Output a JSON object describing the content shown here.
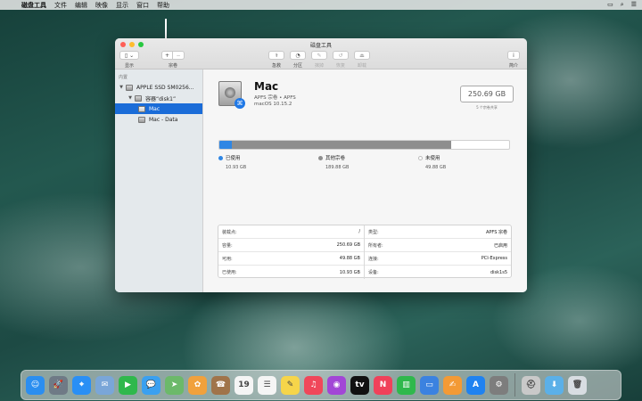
{
  "menubar": {
    "items": [
      "磁盘工具",
      "文件",
      "编辑",
      "映像",
      "显示",
      "窗口",
      "帮助"
    ]
  },
  "window": {
    "title": "磁盘工具",
    "toolbar": {
      "show_label": "显示",
      "volume_label": "宗卷",
      "firstaid_label": "急救",
      "partition_label": "分区",
      "erase_label": "抹掉",
      "restore_label": "恢复",
      "mount_label": "卸载",
      "info_label": "简介"
    }
  },
  "sidebar": {
    "section": "内置",
    "items": [
      {
        "label": "APPLE SSD SM0256..."
      },
      {
        "label": "容器“disk1”"
      },
      {
        "label": "Mac"
      },
      {
        "label": "Mac - Data"
      }
    ]
  },
  "volume": {
    "name": "Mac",
    "subtitle": "APFS 宗卷 • APFS",
    "os": "macOS 10.15.2",
    "capacity": "250.69 GB",
    "capacity_note": "5 个宗卷共享"
  },
  "usage": {
    "used_fraction": 0.0437,
    "other_fraction": 0.7568,
    "colors": {
      "used": "#2f86e4",
      "other": "#8e8e8e",
      "free": "#ffffff"
    },
    "legend": [
      {
        "label": "已使用",
        "value": "10.93 GB"
      },
      {
        "label": "其他宗卷",
        "value": "189.88 GB"
      },
      {
        "label": "未使用",
        "value": "49.88 GB"
      }
    ]
  },
  "info": {
    "left": [
      {
        "k": "装载点:",
        "v": "/"
      },
      {
        "k": "容量:",
        "v": "250.69 GB"
      },
      {
        "k": "可用:",
        "v": "49.88 GB"
      },
      {
        "k": "已使用:",
        "v": "10.93 GB"
      }
    ],
    "right": [
      {
        "k": "类型:",
        "v": "APFS 宗卷"
      },
      {
        "k": "所有者:",
        "v": "已启用"
      },
      {
        "k": "连接:",
        "v": "PCI-Express"
      },
      {
        "k": "设备:",
        "v": "disk1s5"
      }
    ]
  },
  "dock": {
    "apps": [
      {
        "name": "finder-icon",
        "glyph": "☺",
        "color": "#2b8ef0"
      },
      {
        "name": "launchpad-icon",
        "glyph": "🚀",
        "color": "#6f7a86"
      },
      {
        "name": "safari-icon",
        "glyph": "⌖",
        "color": "#2a8ff5"
      },
      {
        "name": "mail-icon",
        "glyph": "✉",
        "color": "#7aa6d8"
      },
      {
        "name": "facetime-icon",
        "glyph": "▶",
        "color": "#2fb84c"
      },
      {
        "name": "messages-icon",
        "glyph": "💬",
        "color": "#3aa0f0"
      },
      {
        "name": "maps-icon",
        "glyph": "➤",
        "color": "#6cb96a"
      },
      {
        "name": "photos-icon",
        "glyph": "✿",
        "color": "#f1a13c"
      },
      {
        "name": "contacts-icon",
        "glyph": "☎",
        "color": "#a0744a"
      },
      {
        "name": "calendar-icon",
        "glyph": "19",
        "color": "#f5f5f5"
      },
      {
        "name": "reminders-icon",
        "glyph": "☰",
        "color": "#f5f5f5"
      },
      {
        "name": "notes-icon",
        "glyph": "✎",
        "color": "#f6d54a"
      },
      {
        "name": "music-icon",
        "glyph": "♫",
        "color": "#f0475a"
      },
      {
        "name": "podcasts-icon",
        "glyph": "◉",
        "color": "#a246d6"
      },
      {
        "name": "tv-icon",
        "glyph": "tv",
        "color": "#111111"
      },
      {
        "name": "news-icon",
        "glyph": "N",
        "color": "#f0415a"
      },
      {
        "name": "numbers-icon",
        "glyph": "▥",
        "color": "#2fb84c"
      },
      {
        "name": "keynote-icon",
        "glyph": "▭",
        "color": "#3b82e0"
      },
      {
        "name": "pages-icon",
        "glyph": "✍",
        "color": "#f39a35"
      },
      {
        "name": "app-store-icon",
        "glyph": "A",
        "color": "#1f82f0"
      },
      {
        "name": "system-preferences-icon",
        "glyph": "⚙",
        "color": "#7d7d7d"
      },
      {
        "name": "disk-utility-icon",
        "glyph": "⛑",
        "color": "#c9c9c9"
      },
      {
        "name": "downloads-folder-icon",
        "glyph": "⬇",
        "color": "#5bb0e8"
      },
      {
        "name": "trash-icon",
        "glyph": "🗑",
        "color": "#d8dde2"
      }
    ]
  }
}
